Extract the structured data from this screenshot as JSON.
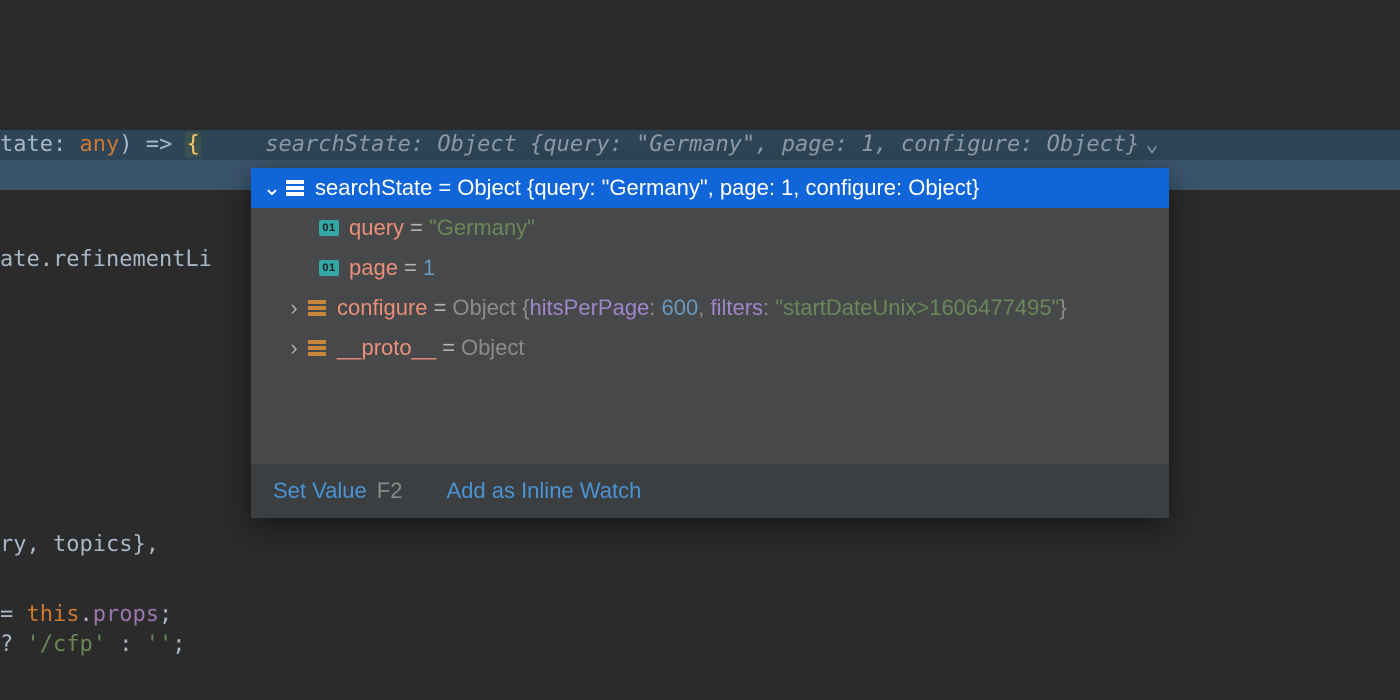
{
  "code": {
    "line1_id": "tate",
    "line1_colon": ": ",
    "line1_type": "any",
    "line1_paren": ")",
    "line1_arrow": " => ",
    "line1_brace": "{",
    "line3": "ate.refinementLi",
    "line5_id": "ry",
    "line5_punc": ", ",
    "line5_obj": "topics",
    "line5_end": "},",
    "line6_eq": " = ",
    "line6_this": "this",
    "line6_dot": ".",
    "line6_prop": "props",
    "line6_semi": ";",
    "line7_q": "? ",
    "line7_str": "'/cfp'",
    "line7_mid": " : ",
    "line7_str2": "''",
    "line7_end": ";"
  },
  "inline": {
    "prefix": "searchState: ",
    "value": "Object {query: \"Germany\", page: 1, configure: Object}"
  },
  "tree": {
    "root": {
      "name": "searchState",
      "summary_prefix": "Object ",
      "summary": "{query: \"Germany\", page: 1, configure: Object}"
    },
    "query": {
      "name": "query",
      "value": "\"Germany\""
    },
    "page": {
      "name": "page",
      "value": "1"
    },
    "configure": {
      "name": "configure",
      "summary_prefix": "Object ",
      "open": "{",
      "k1": "hitsPerPage",
      "v1": "600",
      "sep": ", ",
      "k2": "filters",
      "v2": "\"startDateUnix>1606477495\"",
      "close": "}"
    },
    "proto": {
      "name": "__proto__",
      "value": "Object"
    }
  },
  "footer": {
    "set_value": "Set Value",
    "set_value_shortcut": "F2",
    "add_watch": "Add as Inline Watch"
  },
  "glyphs": {
    "chev_down": "⌄",
    "chev_right": "›",
    "prim_badge": "01"
  }
}
